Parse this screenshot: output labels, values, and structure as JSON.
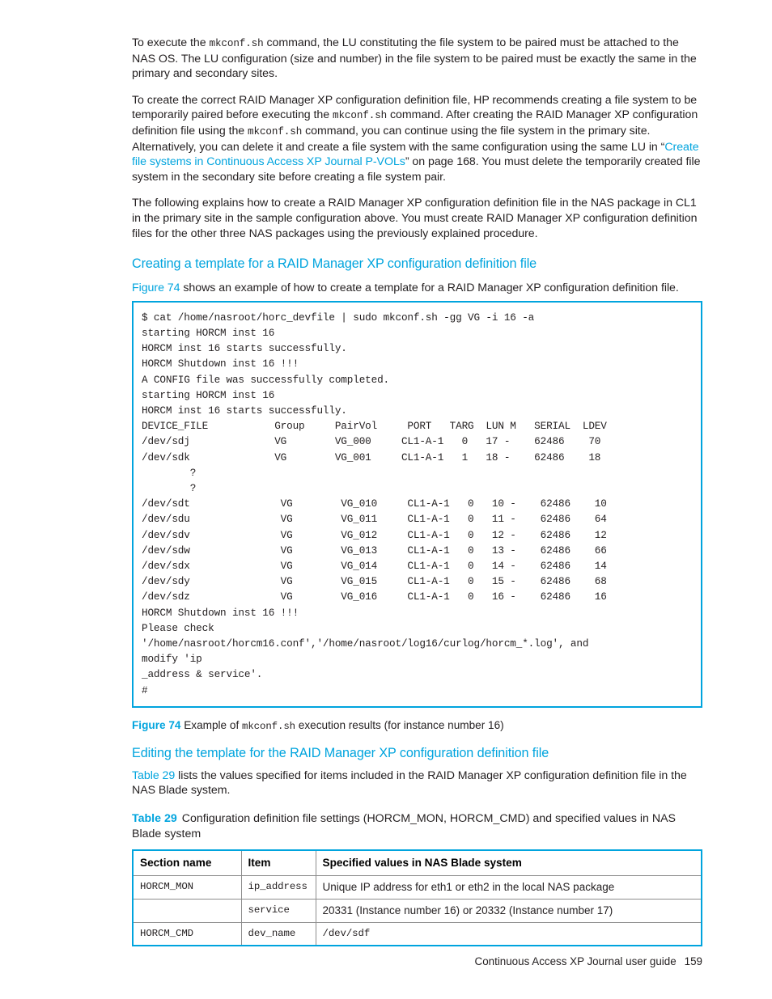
{
  "paragraphs": {
    "p1_part1": "To execute the ",
    "p1_code1": "mkconf.sh",
    "p1_part2": " command, the LU constituting the file system to be paired must be attached to the NAS OS. The LU configuration (size and number) in the file system to be paired must be exactly the same in the primary and secondary sites.",
    "p2_part1": "To create the correct RAID Manager XP configuration definition file, HP recommends creating a file system to be temporarily paired before executing the ",
    "p2_code1": "mkconf.sh",
    "p2_part2": " command. After creating the RAID Manager XP configuration definition file using the ",
    "p2_code2": "mkconf.sh",
    "p2_part3": " command, you can continue using the file system in the primary site. Alternatively, you can delete it and create a file system with the same configuration using the same LU in “",
    "p2_link": "Create file systems in Continuous Access XP Journal P-VOLs",
    "p2_part4": "” on page 168. You must delete the temporarily created file system in the secondary site before creating a file system pair.",
    "p3": "The following explains how to create a RAID Manager XP configuration definition file in the NAS package in CL1 in the primary site in the sample configuration above. You must create RAID Manager XP configuration definition files for the other three NAS packages using the previously explained procedure."
  },
  "heading1": "Creating a template for a RAID Manager XP configuration definition file",
  "figure_intro": {
    "link": "Figure 74",
    "rest": " shows an example of how to create a template for a RAID Manager XP configuration definition file."
  },
  "code_block": {
    "content": "$ cat /home/nasroot/horc_devfile | sudo mkconf.sh -gg VG -i 16 -a\nstarting HORCM inst 16\nHORCM inst 16 starts successfully.\nHORCM Shutdown inst 16 !!!\nA CONFIG file was successfully completed.\nstarting HORCM inst 16\nHORCM inst 16 starts successfully.\nDEVICE_FILE           Group     PairVol     PORT   TARG  LUN M   SERIAL  LDEV\n/dev/sdj              VG        VG_000     CL1-A-1   0   17 -    62486    70\n/dev/sdk              VG        VG_001     CL1-A-1   1   18 -    62486    18\n        ?\n        ?\n/dev/sdt               VG        VG_010     CL1-A-1   0   10 -    62486    10\n/dev/sdu               VG        VG_011     CL1-A-1   0   11 -    62486    64\n/dev/sdv               VG        VG_012     CL1-A-1   0   12 -    62486    12\n/dev/sdw               VG        VG_013     CL1-A-1   0   13 -    62486    66\n/dev/sdx               VG        VG_014     CL1-A-1   0   14 -    62486    14\n/dev/sdy               VG        VG_015     CL1-A-1   0   15 -    62486    68\n/dev/sdz               VG        VG_016     CL1-A-1   0   16 -    62486    16\nHORCM Shutdown inst 16 !!!\nPlease check\n'/home/nasroot/horcm16.conf','/home/nasroot/log16/curlog/horcm_*.log', and\nmodify 'ip\n_address & service'.\n#"
  },
  "figure_caption": {
    "label": "Figure 74",
    "text_before": " Example of ",
    "code": "mkconf.sh",
    "text_after": " execution results (for instance number 16)"
  },
  "heading2": "Editing the template for the RAID Manager XP configuration definition file",
  "table_intro": {
    "link": "Table 29",
    "rest": " lists the values specified for items included in the RAID Manager XP configuration definition file in the NAS Blade system."
  },
  "table_caption": {
    "label": "Table 29",
    "text": "Configuration definition file settings (HORCM_MON, HORCM_CMD) and specified values in NAS Blade system"
  },
  "settings_table": {
    "headers": [
      "Section name",
      "Item",
      "Specified values in NAS Blade system"
    ],
    "rows": [
      {
        "section": "HORCM_MON",
        "item": "ip_address",
        "value": "Unique IP address for eth1 or eth2 in the local NAS package"
      },
      {
        "section": "",
        "item": "service",
        "value": "20331 (Instance number 16) or 20332 (Instance number 17)"
      },
      {
        "section": "HORCM_CMD",
        "item": "dev_name",
        "value": "/dev/sdf"
      }
    ]
  },
  "footer": {
    "guide_title": "Continuous Access XP Journal user guide",
    "page_number": "159"
  },
  "colors": {
    "accent": "#00a4de",
    "text": "#231f20",
    "table_border": "#8d8d8d"
  }
}
